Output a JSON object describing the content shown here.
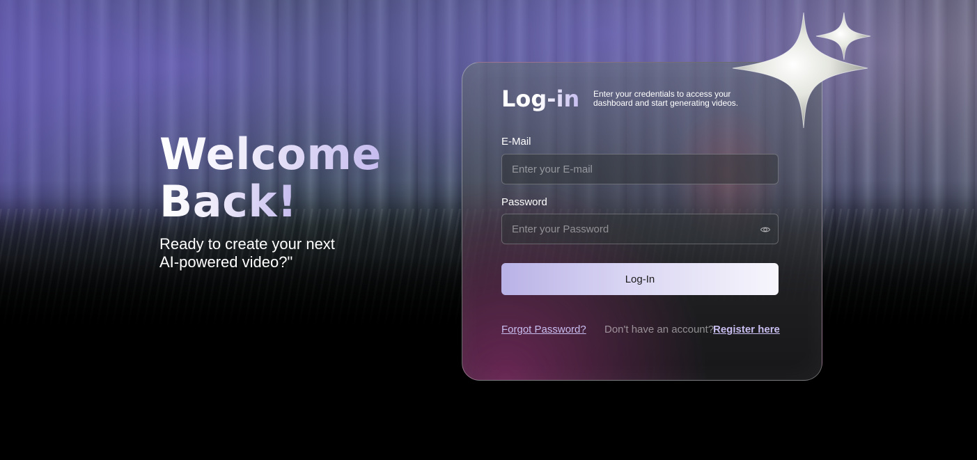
{
  "hero": {
    "title_line1": "Welcome",
    "title_line2": "Back!",
    "subtitle_line1": "Ready to create your next",
    "subtitle_line2": "AI-powered video?\""
  },
  "card": {
    "title": "Log-in",
    "description": "Enter your credentials to access your dashboard and start generating videos.",
    "email": {
      "label": "E-Mail",
      "value": "",
      "placeholder": "Enter your E-mail"
    },
    "password": {
      "label": "Password",
      "value": "",
      "placeholder": "Enter your Password",
      "toggle_icon": "eye-icon"
    },
    "login_button": "Log-In",
    "forgot_password": "Forgot Password?",
    "no_account_text": "Don't have an account?",
    "register_link": "Register here"
  },
  "decoration": {
    "icon": "sparkle-icon"
  },
  "colors": {
    "accent": "#c9bef0",
    "button_gradient_start": "#b9b2e6",
    "button_gradient_end": "#f7f6fc",
    "background": "#000000"
  }
}
